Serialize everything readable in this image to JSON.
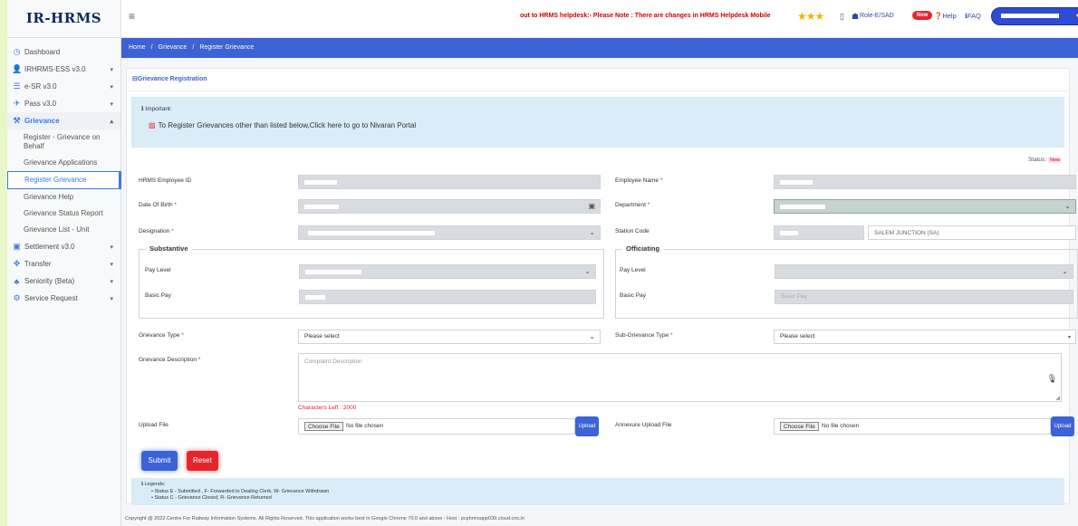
{
  "brand": "IR-HRMS",
  "sidebar": {
    "items": [
      {
        "label": "Dashboard",
        "icon": "dashboard-icon",
        "glyph": "◷"
      },
      {
        "label": "IRHRMS-ESS v3.0",
        "icon": "user-icon",
        "glyph": "👤"
      },
      {
        "label": "e-SR v3.0",
        "icon": "database-icon",
        "glyph": "☰"
      },
      {
        "label": "Pass v3.0",
        "icon": "pass-icon",
        "glyph": "✈"
      },
      {
        "label": "Grievance",
        "icon": "gavel-icon",
        "glyph": "⚒"
      },
      {
        "label": "Settlement v3.0",
        "icon": "money-icon",
        "glyph": "▣"
      },
      {
        "label": "Transfer",
        "icon": "transfer-icon",
        "glyph": "✥"
      },
      {
        "label": "Seniority (Beta)",
        "icon": "seniority-icon",
        "glyph": "♣"
      },
      {
        "label": "Service Request",
        "icon": "cogs-icon",
        "glyph": "⚙"
      }
    ],
    "grievance_sub": [
      "Register - Grievance on Behalf",
      "Grievance Applications",
      "Register Grievance",
      "Grievance Help",
      "Grievance Status Report",
      "Grievance List - Unit"
    ]
  },
  "header": {
    "ticker": "out to HRMS helpdesk:- Please Note : There are changes in HRMS Helpdesk Mobile",
    "stars": "★★★",
    "role": "Role-E/SAD",
    "new_badge": "New",
    "help": "Help",
    "faq": "FAQ"
  },
  "breadcrumb": {
    "home": "Home",
    "sep": "/",
    "grievance": "Grievance",
    "current": "Register Grievance"
  },
  "card": {
    "title": "Grievance Registration",
    "important_label": "Important:",
    "important_text": "To Register Grievances other than listed below,Click here to go to Nivaran Portal",
    "status_label": "Status:",
    "status_value": "New"
  },
  "form": {
    "employee_id_label": "HRMS Employee ID",
    "employee_name_label": "Employee Name",
    "dob_label": "Date Of Birth",
    "department_label": "Department",
    "designation_label": "Designation",
    "station_code_label": "Station Code",
    "station_name": "SALEM JUNCTION (SA)",
    "substantive_legend": "Substantive",
    "officiating_legend": "Officiating",
    "pay_level_label": "Pay Level",
    "basic_pay_label": "Basic Pay",
    "basic_pay_placeholder": "Basic Pay",
    "grievance_type_label": "Grievance Type",
    "grievance_type_value": "Please select",
    "sub_grievance_type_label": "Sub-Grievance Type",
    "sub_grievance_type_value": "Please select",
    "description_label": "Grievance Description",
    "description_placeholder": "Complaint Description",
    "chars_left": "Characters Left : 2000",
    "upload_label": "Upload File",
    "annexure_label": "Annexure Upload File",
    "choose_file": "Choose File",
    "no_file": "No file chosen",
    "upload_button": "Upload",
    "submit": "Submit",
    "reset": "Reset"
  },
  "legends": {
    "title": "Legends:",
    "line1": "Status E - Submitted , F- Forwarded to Dealing Clerk, W- Grievance Withdrawn",
    "line2": "Status C - Grievance Closed, R- Grievance Returned"
  },
  "footer": "Copyright @ 2022 Centre For Railway Information Systems. All Rights Reserved. This application works best in Google Chrome 70.0 and above : Host : pcphrmsapp039.cloud.cris.in"
}
